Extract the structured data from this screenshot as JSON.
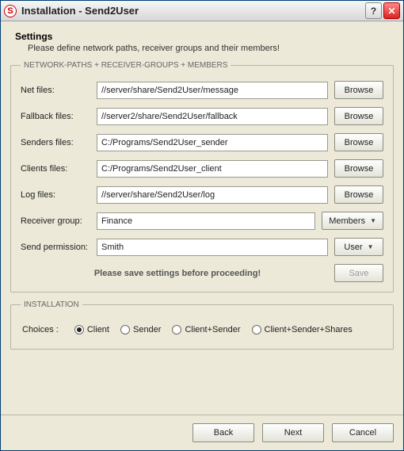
{
  "window": {
    "title": "Installation - Send2User",
    "icon_letter": "S"
  },
  "header": {
    "title": "Settings",
    "subtitle": "Please define network paths, receiver groups and their members!"
  },
  "group1": {
    "legend": "NETWORK-PATHS + RECEIVER-GROUPS + MEMBERS",
    "rows": [
      {
        "label": "Net files:",
        "value": "//server/share/Send2User/message",
        "button": "Browse"
      },
      {
        "label": "Fallback files:",
        "value": "//server2/share/Send2User/fallback",
        "button": "Browse"
      },
      {
        "label": "Senders files:",
        "value": "C:/Programs/Send2User_sender",
        "button": "Browse"
      },
      {
        "label": "Clients files:",
        "value": "C:/Programs/Send2User_client",
        "button": "Browse"
      },
      {
        "label": "Log files:",
        "value": "//server/share/Send2User/log",
        "button": "Browse"
      },
      {
        "label": "Receiver group:",
        "value": "Finance",
        "button": "Members",
        "dropdown": true
      },
      {
        "label": "Send permission:",
        "value": "Smith",
        "button": "User",
        "dropdown": true
      }
    ],
    "save_hint": "Please save settings before proceeding!",
    "save_button": "Save"
  },
  "group2": {
    "legend": "INSTALLATION",
    "choices_label": "Choices :",
    "options": [
      "Client",
      "Sender",
      "Client+Sender",
      "Client+Sender+Shares"
    ],
    "selected": 0
  },
  "footer": {
    "back": "Back",
    "next": "Next",
    "cancel": "Cancel"
  }
}
